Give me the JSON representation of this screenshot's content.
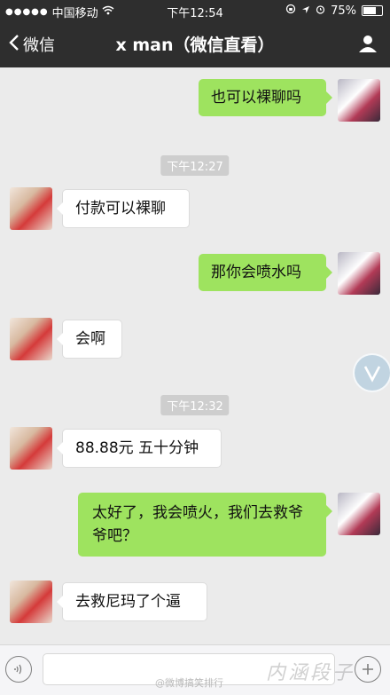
{
  "status_bar": {
    "carrier": "中国移动",
    "time": "下午12:54",
    "battery": "75%",
    "battery_level": 0.75
  },
  "nav": {
    "back_label": "微信",
    "title": "x man（微信直看）"
  },
  "messages": [
    {
      "side": "right",
      "text": "也可以裸聊吗"
    },
    {
      "timestamp": "下午12:27"
    },
    {
      "side": "left",
      "text": "付款可以裸聊"
    },
    {
      "side": "right",
      "text": "那你会喷水吗"
    },
    {
      "side": "left",
      "text": "会啊"
    },
    {
      "timestamp": "下午12:32"
    },
    {
      "side": "left",
      "text": "88.88元 五十分钟"
    },
    {
      "side": "right",
      "text": "太好了，我会喷火，我们去救爷爷吧？"
    },
    {
      "side": "left",
      "text": "去救尼玛了个逼"
    }
  ],
  "watermark": {
    "weibo": "@微博搞笑排行",
    "corner": "内涵段子"
  }
}
